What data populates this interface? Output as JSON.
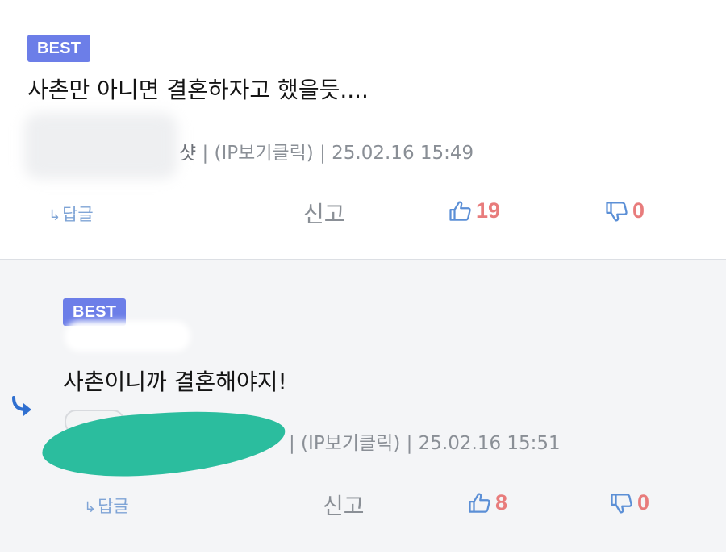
{
  "comments": [
    {
      "badge": "BEST",
      "text": "사촌만 아니면 결혼하자고 했을듯....",
      "nick_tail": "샷",
      "meta": " | (IP보기클릭) | 25.02.16 15:49",
      "reply_label": "답글",
      "report_label": "신고",
      "likes": "19",
      "dislikes": "0"
    },
    {
      "badge": "BEST",
      "text": "사촌이니까 결혼해야지!",
      "nick_tail": "",
      "meta": " | (IP보기클릭) | 25.02.16 15:51",
      "reply_label": "답글",
      "report_label": "신고",
      "likes": "8",
      "dislikes": "0"
    }
  ],
  "icons": {
    "reply_arrow": "↳",
    "thumbs_up": "thumbs-up-icon",
    "thumbs_down": "thumbs-down-icon",
    "reply_indicator": "reply-arrow-icon"
  },
  "colors": {
    "badge": "#6c7ee8",
    "vote_count": "#e87c7c",
    "icon_blue": "#5b8fd6",
    "reply_link": "#7fa4d6",
    "meta": "#8a8f96",
    "reply_bg": "#f4f5f7",
    "redaction": "#2bbd9e"
  }
}
